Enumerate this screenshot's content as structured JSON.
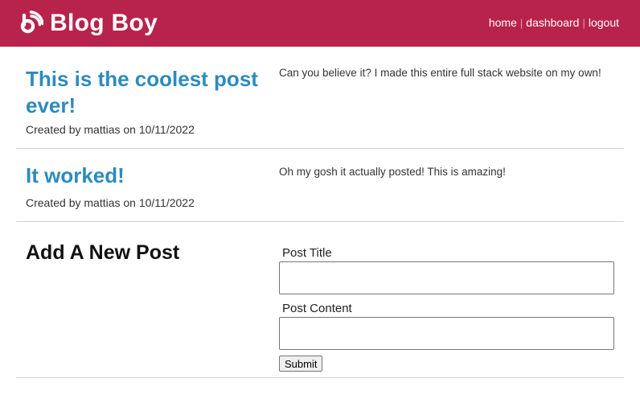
{
  "header": {
    "brand": "Blog Boy",
    "background": "#b8234b",
    "nav": [
      {
        "label": "home"
      },
      {
        "label": "dashboard"
      },
      {
        "label": "logout"
      }
    ]
  },
  "posts": [
    {
      "title": "This is the coolest post ever!",
      "meta": "Created by mattias on 10/11/2022",
      "content": "Can you believe it? I made this entire full stack website on my own!"
    },
    {
      "title": "It worked!",
      "meta": "Created by mattias on 10/11/2022",
      "content": "Oh my gosh it actually posted! This is amazing!"
    }
  ],
  "new_post": {
    "heading": "Add A New Post",
    "title_label": "Post Title",
    "title_value": "",
    "content_label": "Post Content",
    "content_value": "",
    "submit_label": "Submit"
  },
  "colors": {
    "accent": "#b8234b",
    "link": "#2c8bc0"
  },
  "icons": {
    "brand": "rss-feed-icon"
  }
}
